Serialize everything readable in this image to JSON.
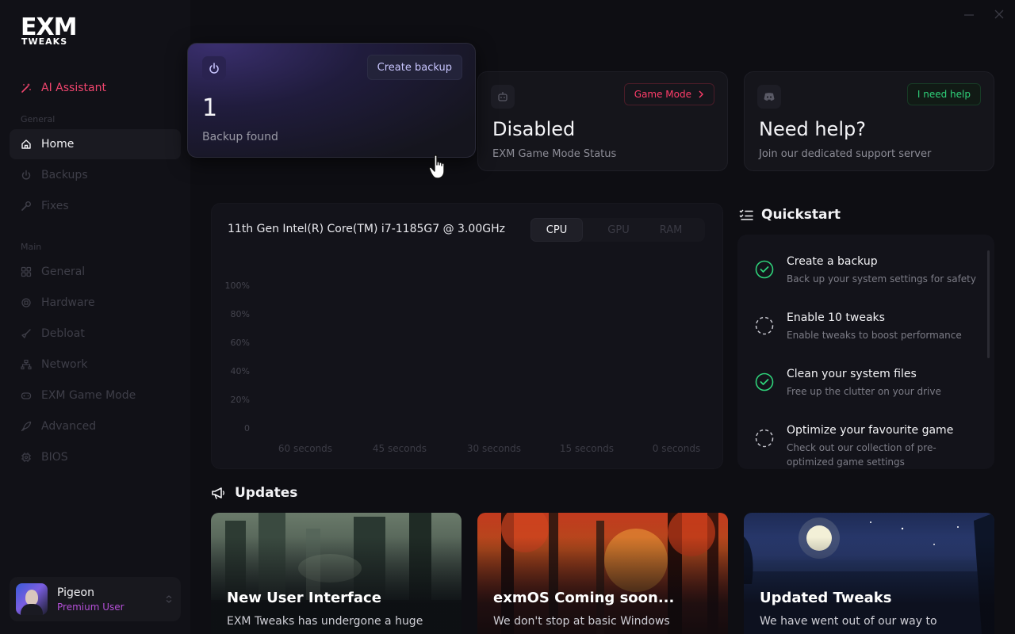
{
  "sidebar": {
    "logo": {
      "main": "EXM",
      "sub": "TWEAKS"
    },
    "ai_item": "AI Assistant",
    "section_general": "General",
    "section_main": "Main",
    "items": [
      {
        "label": "Home",
        "icon": "home-icon"
      },
      {
        "label": "Backups",
        "icon": "power-icon"
      },
      {
        "label": "Fixes",
        "icon": "wrench-icon"
      },
      {
        "label": "General",
        "icon": "grid-icon"
      },
      {
        "label": "Hardware",
        "icon": "cpu-icon"
      },
      {
        "label": "Debloat",
        "icon": "broom-icon"
      },
      {
        "label": "Network",
        "icon": "network-icon"
      },
      {
        "label": "EXM Game Mode",
        "icon": "gamepad-icon"
      },
      {
        "label": "Advanced",
        "icon": "rocket-icon"
      },
      {
        "label": "BIOS",
        "icon": "chip-icon"
      }
    ],
    "active_item": "Home",
    "user": {
      "name": "Pigeon",
      "role": "Premium User"
    }
  },
  "cards": {
    "backup": {
      "button": "Create backup",
      "count": "1",
      "label": "Backup found"
    },
    "game_mode": {
      "button": "Game Mode",
      "status": "Disabled",
      "label": "EXM Game Mode Status"
    },
    "help": {
      "button": "I need help",
      "title": "Need help?",
      "label": "Join our dedicated support server"
    }
  },
  "usage": {
    "cpu_name": "11th Gen Intel(R) Core(TM) i7-1185G7 @ 3.00GHz",
    "tabs": [
      "CPU",
      "GPU",
      "RAM"
    ],
    "active_tab": "CPU"
  },
  "chart_data": {
    "type": "line",
    "title": "",
    "xlabel": "",
    "ylabel": "",
    "x_ticks": [
      "60 seconds",
      "45 seconds",
      "30 seconds",
      "15 seconds",
      "0 seconds"
    ],
    "y_ticks": [
      "100%",
      "80%",
      "60%",
      "40%",
      "20%",
      "0"
    ],
    "ylim": [
      0,
      100
    ],
    "series": []
  },
  "quickstart": {
    "title": "Quickstart",
    "items": [
      {
        "title": "Create a backup",
        "desc": "Back up your system settings for safety",
        "done": true
      },
      {
        "title": "Enable 10 tweaks",
        "desc": "Enable tweaks to boost performance",
        "done": false
      },
      {
        "title": "Clean your system files",
        "desc": "Free up the clutter on your drive",
        "done": true
      },
      {
        "title": "Optimize your favourite game",
        "desc": "Check out our collection of pre-optimized game settings",
        "done": false
      }
    ]
  },
  "updates": {
    "title": "Updates",
    "items": [
      {
        "title": "New User Interface",
        "desc": "EXM Tweaks has undergone a huge"
      },
      {
        "title": "exmOS Coming soon...",
        "desc": "We don't stop at basic Windows"
      },
      {
        "title": "Updated Tweaks",
        "desc": "We have went out of our way to"
      }
    ]
  },
  "colors": {
    "accent_pink": "#f0456e",
    "accent_green": "#2fd27a",
    "premium_purple": "#b34fd6",
    "game_mode_red": "#ff3d6a"
  }
}
